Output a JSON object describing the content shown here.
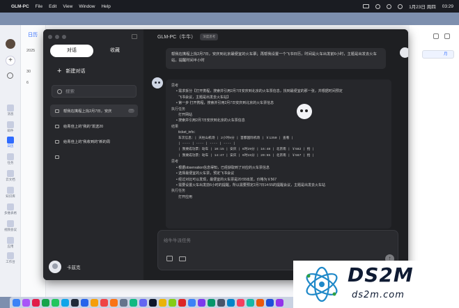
{
  "menubar": {
    "app_name": "GLM-PC",
    "menus": [
      "File",
      "Edit",
      "View",
      "Window",
      "Help"
    ],
    "datetime": "1月23日 周四",
    "time": "03:29"
  },
  "calendar_bg": {
    "sidebar_title": "日历",
    "year_label": "2025",
    "row1": "30",
    "row2": "6",
    "rail_labels": [
      "消息",
      "邮件",
      "日历",
      "任务",
      "云文档",
      "知识库",
      "多维表格",
      "视频会议",
      "应用",
      "工作台"
    ],
    "right_tab": "月"
  },
  "sidebar": {
    "tabs": [
      "对话",
      "收藏"
    ],
    "active_tab": 0,
    "new_chat_label": "新建对话",
    "search_placeholder": "搜索",
    "history": [
      {
        "title": "帮我在携程上找2月7日，安庆",
        "active": true
      },
      {
        "title": "给青佳上的“我的”发送20",
        "active": false
      },
      {
        "title": "给青佳上的“我收到的”新的周",
        "active": false
      },
      {
        "title": "",
        "active": false
      }
    ],
    "more_label": "···",
    "user_name": "卡兹克"
  },
  "chat": {
    "title": "GLM-PC（牛牛）",
    "badge": "深度思考",
    "user_message": "帮我在携程上找2月7日，安庆到北京最便宜的火车票；再帮我设置一个飞书日历，时间是火车出发前6小时，主题是出发去火车站，提醒时间半小时",
    "response_lines": [
      {
        "type": "h",
        "text": "思考"
      },
      {
        "type": "b",
        "text": "• 需求拆分【打开携程，搜索并引用2月7日安庆到北京的火车票信息，找到最便宜的那一张，并根据时间预定"
      },
      {
        "type": "i",
        "text": "飞书会议，主题是出发去火车站】"
      },
      {
        "type": "b",
        "text": "• 第一步 打开携程，搜索并引用2月7日安庆到北京的火车票信息"
      },
      {
        "type": "h",
        "text": "执行任务"
      },
      {
        "type": "i",
        "text": "打开网站"
      },
      {
        "type": "b",
        "text": "• 搜索并引用2月7日安庆到北京的火车票信息"
      },
      {
        "type": "h",
        "text": "结果"
      },
      {
        "type": "i",
        "text": "ticket_info："
      },
      {
        "type": "mono",
        "text": "车次信息：| 天柱山机场 | 2小时9分 | 首都国际机场 | ￥1350 | 查看 |"
      },
      {
        "type": "mono",
        "text": "| ---- | ---- | ---- | ---- |"
      },
      {
        "type": "mono",
        "text": "| 我要成功票：动车 | 10:15 | 安庆 | 6时29分 | 16:48 | 北京南 | ￥582 | 抢 |"
      },
      {
        "type": "mono",
        "text": "| 我要成功票：动车 | 14:47 | 安庆 | 6时15分 | 20:55 | 北京南 | ￥567 | 抢 |"
      },
      {
        "type": "h",
        "text": "思考"
      },
      {
        "type": "b",
        "text": "• 根据observation信息得知，已经获取到了对应的火车票信息"
      },
      {
        "type": "b",
        "text": "• 选择最便宜的火车票，预定飞书会议"
      },
      {
        "type": "b",
        "text": "• 经过对比可以发现，最便宜的火车票是20:55出发，价格为￥567"
      },
      {
        "type": "b",
        "text": "• 需要设置火车出发前6小时的提醒，所以需要预定2月7日14:55的提醒会议，主题是出发去火车站"
      },
      {
        "type": "h",
        "text": "执行任务"
      },
      {
        "type": "i",
        "text": "打开应用"
      }
    ],
    "input_placeholder": "给牛牛派任务",
    "send_glyph": "↑"
  },
  "watermark": {
    "brand": "DS2M",
    "domain": "ds2m.com"
  },
  "colors": {
    "window_bg": "#1e1f22",
    "sidebar_bg": "#26272b",
    "accent": "#2f6bff"
  }
}
